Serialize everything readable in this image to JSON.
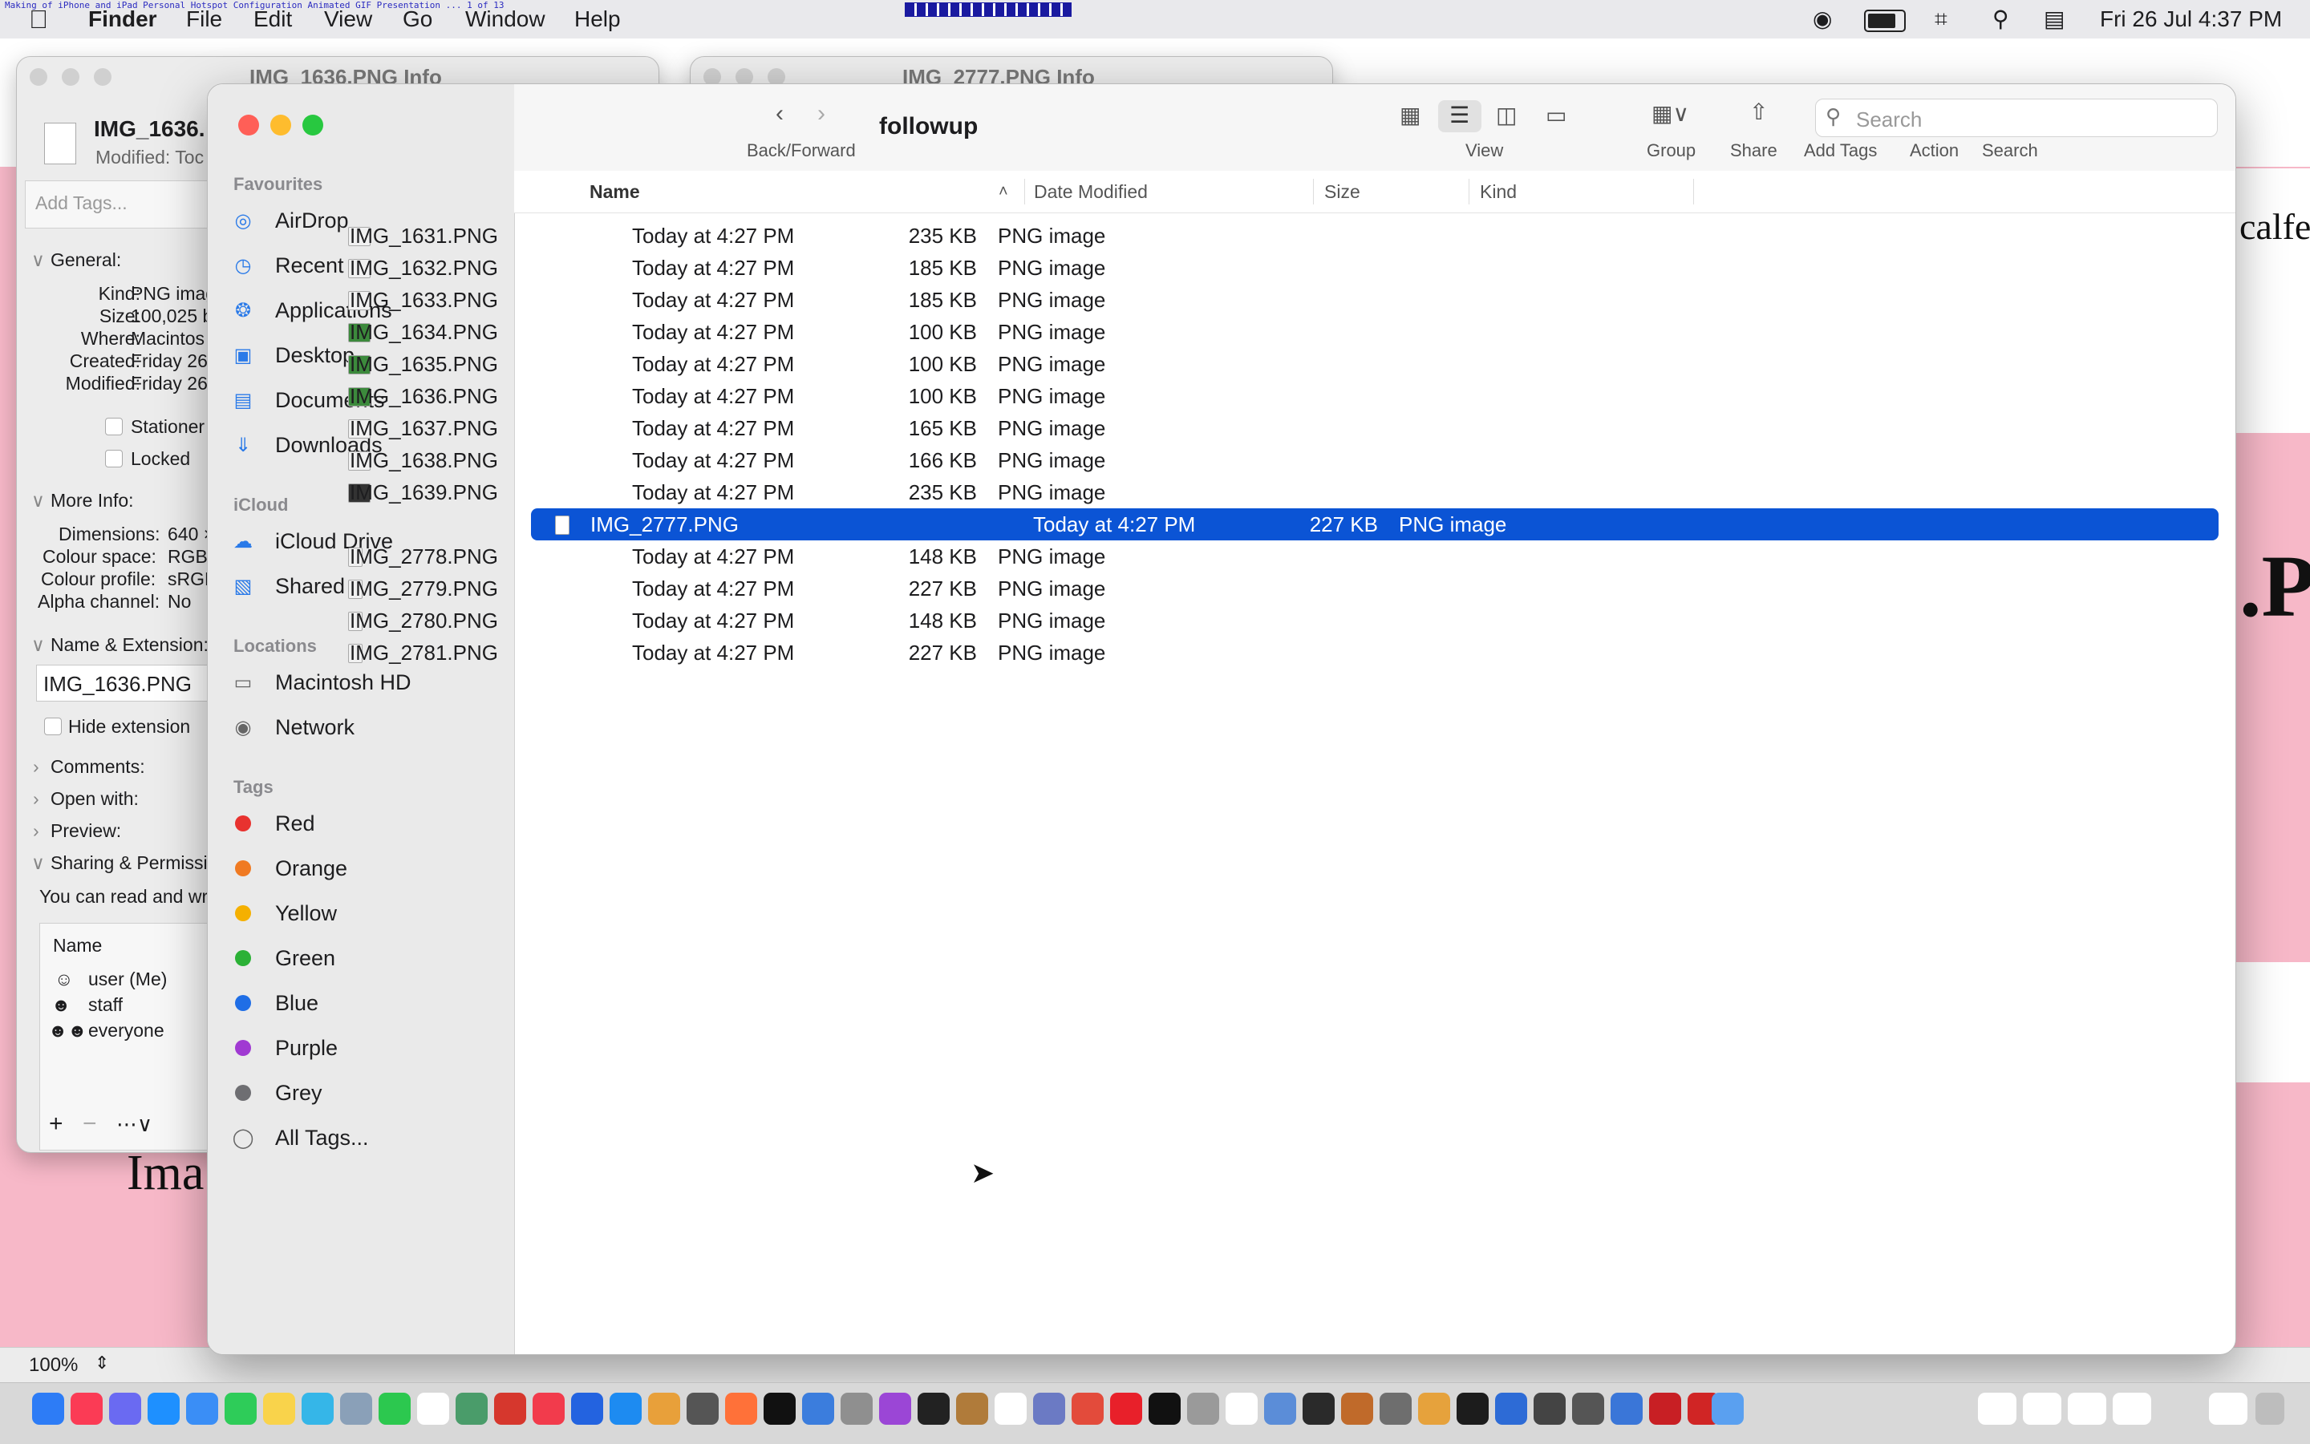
{
  "menubar": {
    "app": "Finder",
    "items": [
      "File",
      "Edit",
      "View",
      "Go",
      "Window",
      "Help"
    ],
    "date_time": "Fri 26 Jul  4:37 PM",
    "tiny_title": "Making of iPhone and iPad Personal Hotspot Configuration Animated GIF Presentation ... 1 of 13"
  },
  "background": {
    "text_right_1": "calfe",
    "text_right_2": ".P",
    "text_left": "Ima",
    "zoom": "100%"
  },
  "info_window_1": {
    "title": "IMG_1636.PNG Info",
    "filename": "IMG_1636.",
    "modified": "Modified: Toc",
    "add_tags_placeholder": "Add Tags...",
    "general_header": "General:",
    "kind_label": "Kind:",
    "kind_value": "PNG imag",
    "size_label": "Size:",
    "size_value": "100,025 b",
    "where_label": "Where:",
    "where_value": "Macintos",
    "created_label": "Created:",
    "created_value": "Friday 26",
    "modified_label": "Modified:",
    "modified_value": "Friday 26",
    "stationery": "Stationer",
    "locked": "Locked",
    "more_info_header": "More Info:",
    "dimensions_label": "Dimensions:",
    "dimensions_value": "640 ×",
    "colour_space_label": "Colour space:",
    "colour_space_value": "RGB",
    "colour_profile_label": "Colour profile:",
    "colour_profile_value": "sRGB",
    "alpha_label": "Alpha channel:",
    "alpha_value": "No",
    "name_ext_header": "Name & Extension:",
    "name_field": "IMG_1636.PNG",
    "hide_extension": "Hide extension",
    "comments": "Comments:",
    "open_with": "Open with:",
    "preview": "Preview:",
    "sharing": "Sharing & Permissi",
    "can_read": "You can read and wr",
    "perm_name_header": "Name",
    "perm_users": [
      "user (Me)",
      "staff",
      "everyone"
    ]
  },
  "info_window_2": {
    "title": "IMG_2777.PNG Info"
  },
  "finder": {
    "folder": "followup",
    "back_forward_label": "Back/Forward",
    "view_label": "View",
    "group_label": "Group",
    "share_label": "Share",
    "add_tags_label": "Add Tags",
    "action_label": "Action",
    "search_label": "Search",
    "search_placeholder": "Search",
    "sidebar": {
      "favourites_header": "Favourites",
      "favourites": [
        "AirDrop",
        "Recent",
        "Applications",
        "Desktop",
        "Documents",
        "Downloads"
      ],
      "icloud_header": "iCloud",
      "icloud": [
        "iCloud Drive",
        "Shared"
      ],
      "locations_header": "Locations",
      "locations": [
        "Macintosh HD",
        "Network"
      ],
      "tags_header": "Tags",
      "tags": [
        {
          "name": "Red",
          "color": "#e8322f"
        },
        {
          "name": "Orange",
          "color": "#f07a22"
        },
        {
          "name": "Yellow",
          "color": "#f5b000"
        },
        {
          "name": "Green",
          "color": "#2bb136"
        },
        {
          "name": "Blue",
          "color": "#1f6ee6"
        },
        {
          "name": "Purple",
          "color": "#a03ad2"
        },
        {
          "name": "Grey",
          "color": "#6e6e72"
        }
      ],
      "all_tags": "All Tags..."
    },
    "columns": {
      "name": "Name",
      "date": "Date Modified",
      "size": "Size",
      "kind": "Kind"
    },
    "files": [
      {
        "name": "IMG_1631.PNG",
        "date": "Today at 4:27 PM",
        "size": "235 KB",
        "kind": "PNG image"
      },
      {
        "name": "IMG_1632.PNG",
        "date": "Today at 4:27 PM",
        "size": "185 KB",
        "kind": "PNG image"
      },
      {
        "name": "IMG_1633.PNG",
        "date": "Today at 4:27 PM",
        "size": "185 KB",
        "kind": "PNG image"
      },
      {
        "name": "IMG_1634.PNG",
        "date": "Today at 4:27 PM",
        "size": "100 KB",
        "kind": "PNG image"
      },
      {
        "name": "IMG_1635.PNG",
        "date": "Today at 4:27 PM",
        "size": "100 KB",
        "kind": "PNG image"
      },
      {
        "name": "IMG_1636.PNG",
        "date": "Today at 4:27 PM",
        "size": "100 KB",
        "kind": "PNG image"
      },
      {
        "name": "IMG_1637.PNG",
        "date": "Today at 4:27 PM",
        "size": "165 KB",
        "kind": "PNG image"
      },
      {
        "name": "IMG_1638.PNG",
        "date": "Today at 4:27 PM",
        "size": "166 KB",
        "kind": "PNG image"
      },
      {
        "name": "IMG_1639.PNG",
        "date": "Today at 4:27 PM",
        "size": "235 KB",
        "kind": "PNG image"
      },
      {
        "name": "IMG_2777.PNG",
        "date": "Today at 4:27 PM",
        "size": "227 KB",
        "kind": "PNG image"
      },
      {
        "name": "IMG_2778.PNG",
        "date": "Today at 4:27 PM",
        "size": "148 KB",
        "kind": "PNG image"
      },
      {
        "name": "IMG_2779.PNG",
        "date": "Today at 4:27 PM",
        "size": "227 KB",
        "kind": "PNG image"
      },
      {
        "name": "IMG_2780.PNG",
        "date": "Today at 4:27 PM",
        "size": "148 KB",
        "kind": "PNG image"
      },
      {
        "name": "IMG_2781.PNG",
        "date": "Today at 4:27 PM",
        "size": "227 KB",
        "kind": "PNG image"
      }
    ],
    "selected_file": "IMG_2777.PNG",
    "selection_color": "#0b54d5"
  }
}
